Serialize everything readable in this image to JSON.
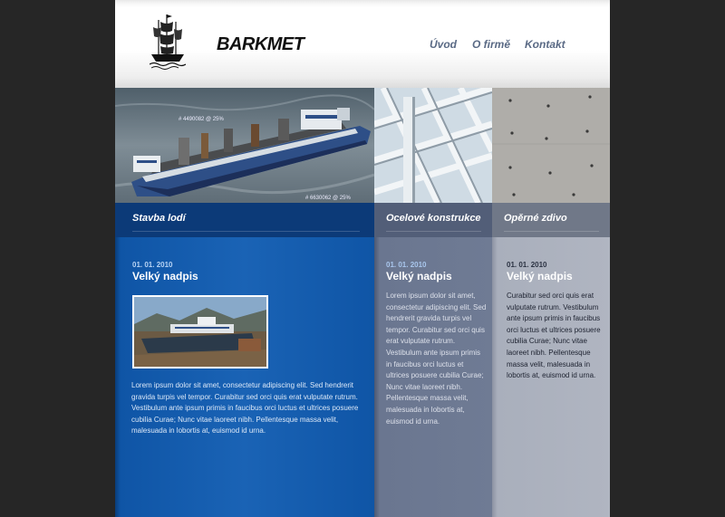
{
  "site": {
    "brand": "BARKMET",
    "logo_icon": "sailing-ship-icon"
  },
  "nav": [
    {
      "label": "Úvod"
    },
    {
      "label": "O firmě"
    },
    {
      "label": "Kontakt"
    }
  ],
  "banner": {
    "photos": [
      {
        "name": "cargo-ship-photo",
        "overlay_texts": [
          "# 4490082 @ 25%",
          "# 6630062 @ 25%"
        ]
      },
      {
        "name": "steel-structure-photo"
      },
      {
        "name": "concrete-wall-photo"
      }
    ]
  },
  "columns": [
    {
      "title": "Stavba lodí",
      "date": "01. 01. 2010",
      "heading": "Velký nadpis",
      "thumbnail": "boat-on-shore-image",
      "body": "Lorem ipsum dolor sit amet, consectetur adipiscing elit. Sed hendrerit gravida turpis vel tempor. Curabitur sed orci quis erat vulputate rutrum. Vestibulum ante ipsum primis in faucibus orci luctus et ultrices posuere cubilia Curae; Nunc vitae laoreet nibh. Pellentesque massa velit, malesuada in lobortis at, euismod id urna."
    },
    {
      "title": "Ocelové konstrukce",
      "date": "01. 01. 2010",
      "heading": "Velký nadpis",
      "body": "Lorem ipsum dolor sit amet, consectetur adipiscing elit. Sed hendrerit gravida turpis vel tempor. Curabitur sed orci quis erat vulputate rutrum. Vestibulum ante ipsum primis in faucibus orci luctus et ultrices posuere cubilia Curae; Nunc vitae laoreet nibh. Pellentesque massa velit, malesuada in lobortis at, euismod id urna."
    },
    {
      "title": "Opěrné zdivo",
      "date": "01. 01. 2010",
      "heading": "Velký nadpis",
      "body": "Curabitur sed orci quis erat vulputate rutrum. Vestibulum ante ipsum primis in faucibus orci luctus et ultrices posuere cubilia Curae; Nunc vitae laoreet nibh. Pellentesque massa velit, malesuada in lobortis at, euismod id urna."
    }
  ],
  "colors": {
    "background": "#262626",
    "col1": "#1a63b5",
    "col2": "#6f7b94",
    "col3": "#b0b5c1",
    "nav": "#5a6a85"
  }
}
